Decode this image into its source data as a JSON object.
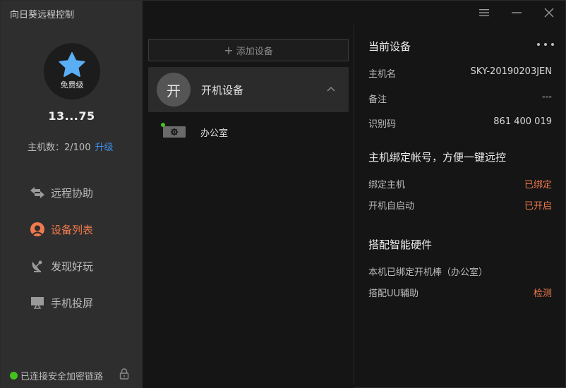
{
  "app": {
    "title": "向日葵远程控制"
  },
  "user": {
    "tier": "免费级",
    "id": "13...75",
    "host_count": "主机数：2/100",
    "upgrade_label": "升级"
  },
  "nav": [
    {
      "label": "远程协助",
      "icon": "swap-arrows-icon"
    },
    {
      "label": "设备列表",
      "icon": "sunflower-icon"
    },
    {
      "label": "发现好玩",
      "icon": "satellite-dish-icon"
    },
    {
      "label": "手机投屏",
      "icon": "screen-cast-icon"
    }
  ],
  "nav_active": "设备列表",
  "footer": {
    "status": "已连接安全加密链路"
  },
  "devices": {
    "add_label": "添加设备",
    "group": {
      "avatar_char": "开",
      "name": "开机设备"
    },
    "items": [
      {
        "name": "办公室",
        "online": true
      }
    ]
  },
  "details": {
    "current_title": "当前设备",
    "current_rows": [
      {
        "key": "主机名",
        "value": "SKY-20190203JEN"
      },
      {
        "key": "备注",
        "value": "---"
      },
      {
        "key": "识别码",
        "value": "861 400 019"
      }
    ],
    "bind_title": "主机绑定帐号，方便一键远控",
    "bind_rows": [
      {
        "key": "绑定主机",
        "value": "已绑定"
      },
      {
        "key": "开机自启动",
        "value": "已开启"
      }
    ],
    "hw_title": "搭配智能硬件",
    "hw_rows": [
      {
        "key": "本机已绑定开机棒（办公室）",
        "value": ""
      },
      {
        "key": "搭配UU辅助",
        "value": "检测"
      }
    ]
  },
  "colors": {
    "accent": "#f07a4d",
    "link": "#3d8ee8",
    "online": "#44c21c",
    "star": "#5aaef5"
  }
}
